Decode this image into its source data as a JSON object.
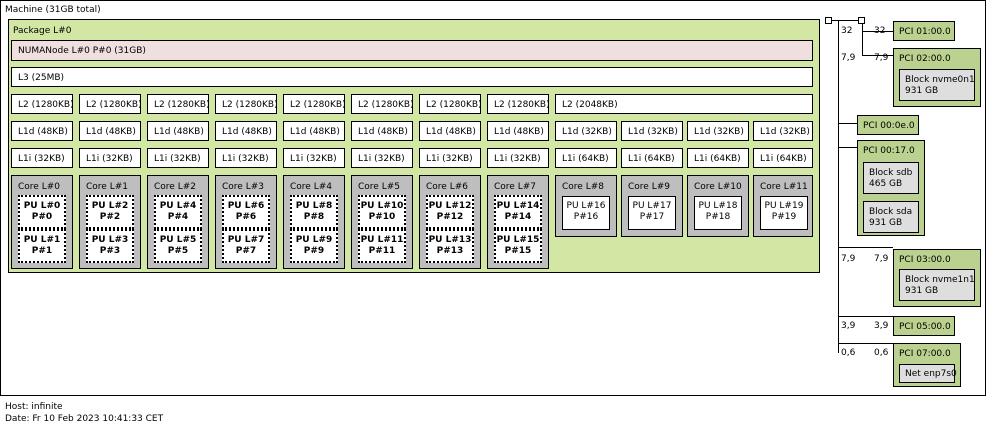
{
  "machine_label": "Machine (31GB total)",
  "package_label": "Package L#0",
  "numa_label": "NUMANode L#0 P#0 (31GB)",
  "l3_label": "L3 (25MB)",
  "l2": [
    "L2 (1280KB)",
    "L2 (1280KB)",
    "L2 (1280KB)",
    "L2 (1280KB)",
    "L2 (1280KB)",
    "L2 (1280KB)",
    "L2 (1280KB)",
    "L2 (1280KB)",
    "L2 (2048KB)"
  ],
  "l1d": [
    "L1d (48KB)",
    "L1d (48KB)",
    "L1d (48KB)",
    "L1d (48KB)",
    "L1d (48KB)",
    "L1d (48KB)",
    "L1d (48KB)",
    "L1d (48KB)",
    "L1d (32KB)",
    "L1d (32KB)",
    "L1d (32KB)",
    "L1d (32KB)"
  ],
  "l1i": [
    "L1i (32KB)",
    "L1i (32KB)",
    "L1i (32KB)",
    "L1i (32KB)",
    "L1i (32KB)",
    "L1i (32KB)",
    "L1i (32KB)",
    "L1i (32KB)",
    "L1i (64KB)",
    "L1i (64KB)",
    "L1i (64KB)",
    "L1i (64KB)"
  ],
  "cores": [
    {
      "label": "Core L#0",
      "pus": [
        [
          "PU L#0",
          "P#0"
        ],
        [
          "PU L#1",
          "P#1"
        ]
      ]
    },
    {
      "label": "Core L#1",
      "pus": [
        [
          "PU L#2",
          "P#2"
        ],
        [
          "PU L#3",
          "P#3"
        ]
      ]
    },
    {
      "label": "Core L#2",
      "pus": [
        [
          "PU L#4",
          "P#4"
        ],
        [
          "PU L#5",
          "P#5"
        ]
      ]
    },
    {
      "label": "Core L#3",
      "pus": [
        [
          "PU L#6",
          "P#6"
        ],
        [
          "PU L#7",
          "P#7"
        ]
      ]
    },
    {
      "label": "Core L#4",
      "pus": [
        [
          "PU L#8",
          "P#8"
        ],
        [
          "PU L#9",
          "P#9"
        ]
      ]
    },
    {
      "label": "Core L#5",
      "pus": [
        [
          "PU L#10",
          "P#10"
        ],
        [
          "PU L#11",
          "P#11"
        ]
      ]
    },
    {
      "label": "Core L#6",
      "pus": [
        [
          "PU L#12",
          "P#12"
        ],
        [
          "PU L#13",
          "P#13"
        ]
      ]
    },
    {
      "label": "Core L#7",
      "pus": [
        [
          "PU L#14",
          "P#14"
        ],
        [
          "PU L#15",
          "P#15"
        ]
      ]
    },
    {
      "label": "Core L#8",
      "pus": [
        [
          "PU L#16",
          "P#16"
        ]
      ]
    },
    {
      "label": "Core L#9",
      "pus": [
        [
          "PU L#17",
          "P#17"
        ]
      ]
    },
    {
      "label": "Core L#10",
      "pus": [
        [
          "PU L#18",
          "P#18"
        ]
      ]
    },
    {
      "label": "Core L#11",
      "pus": [
        [
          "PU L#19",
          "P#19"
        ]
      ]
    }
  ],
  "pci": {
    "p1": {
      "label": "PCI 01:00.0",
      "bw_left": "32",
      "bw_right": "32"
    },
    "p2": {
      "label": "PCI 02:00.0",
      "bw_left": "7,9",
      "bw_right": "7,9",
      "block": [
        "Block nvme0n1",
        "931 GB"
      ]
    },
    "p3": {
      "label": "PCI 00:0e.0"
    },
    "p4": {
      "label": "PCI 00:17.0",
      "block1": [
        "Block sdb",
        "465 GB"
      ],
      "block2": [
        "Block sda",
        "931 GB"
      ]
    },
    "p5": {
      "label": "PCI 03:00.0",
      "bw_left": "7,9",
      "bw_right": "7,9",
      "block": [
        "Block nvme1n1",
        "931 GB"
      ]
    },
    "p6": {
      "label": "PCI 05:00.0",
      "bw_left": "3,9",
      "bw_right": "3,9"
    },
    "p7": {
      "label": "PCI 07:00.0",
      "bw_left": "0,6",
      "bw_right": "0,6",
      "block": [
        "Net enp7s0"
      ]
    }
  },
  "host_label": "Host: infinite",
  "date_label": "Date: Fr 10 Feb 2023 10:41:33 CET",
  "colors": {
    "package": "#d2e7a4",
    "numa": "#efdfdf",
    "core": "#bebebe",
    "pci": "#bbd18f",
    "block": "#dedede"
  }
}
